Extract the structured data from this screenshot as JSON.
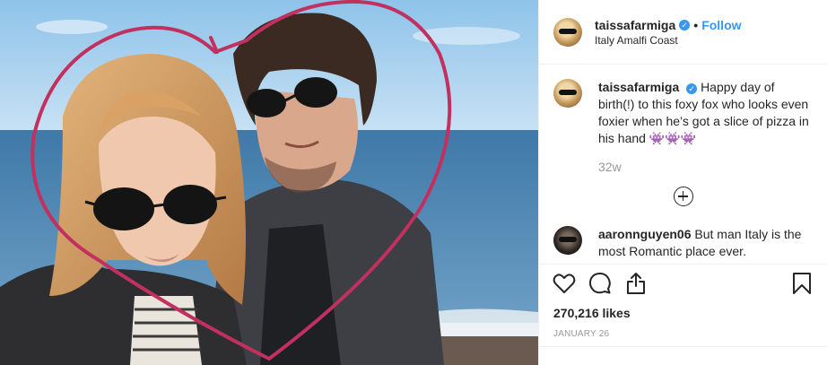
{
  "post": {
    "username": "taissafarmiga",
    "follow_label": "Follow",
    "location": "Italy Amalfi Coast",
    "caption": "Happy day of birth(!) to this foxy fox who looks even foxier when he’s got a slice of pizza in his hand 👾👾👾",
    "caption_age": "32w",
    "likes": "270,216 likes",
    "date": "JANUARY 26"
  },
  "comments": [
    {
      "username": "aaronnguyen06",
      "text": "But man Italy is the most Romantic place ever."
    }
  ],
  "icons": {
    "verified": "✓",
    "like": "heart-icon",
    "comment": "comment-icon",
    "share": "share-icon",
    "save": "bookmark-icon",
    "load_more": "plus-circle-icon"
  },
  "colors": {
    "link_blue": "#3897f0",
    "muted": "#999999",
    "heart_drawing": "#c2305f"
  }
}
